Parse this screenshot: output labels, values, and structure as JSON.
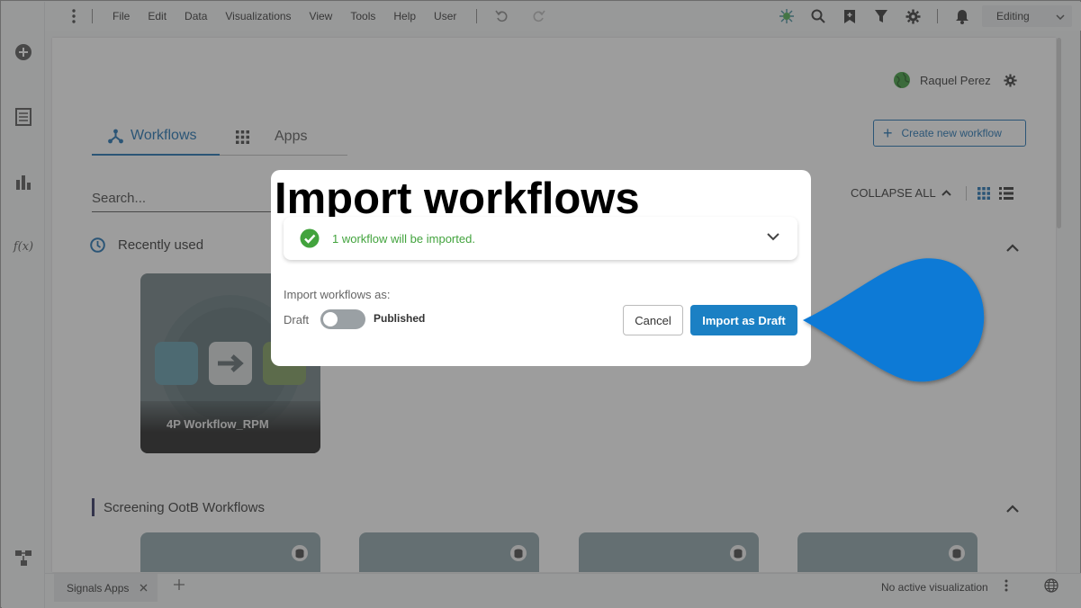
{
  "menubar": {
    "items": [
      "File",
      "Edit",
      "Data",
      "Visualizations",
      "View",
      "Tools",
      "Help",
      "User"
    ],
    "mode": "Editing"
  },
  "user": {
    "name": "Raquel Perez"
  },
  "tabs": [
    {
      "label": "Workflows",
      "active": true
    },
    {
      "label": "Apps",
      "active": false
    }
  ],
  "create_button": "Create new workflow",
  "search": {
    "placeholder": "Search..."
  },
  "collapse_all": "COLLAPSE ALL",
  "sections": {
    "recent": {
      "title": "Recently used",
      "tiles": [
        {
          "label": "4P Workflow_RPM"
        }
      ]
    },
    "screening": {
      "title": "Screening OotB Workflows",
      "tile_count": 4
    }
  },
  "bottom_bar": {
    "tab_label": "Signals Apps",
    "status": "No active visualization"
  },
  "dialog": {
    "title": "Import workflows",
    "summary": "1 workflow will be imported.",
    "import_as_label": "Import workflows as:",
    "toggle": {
      "off_label": "Draft",
      "on_label": "Published",
      "on": false
    },
    "cancel_label": "Cancel",
    "confirm_label": "Import as Draft"
  },
  "colors": {
    "accent": "#1a6fb0",
    "primary_button": "#1b80c4",
    "success": "#42a33d",
    "pointer": "#0a7ad6"
  }
}
